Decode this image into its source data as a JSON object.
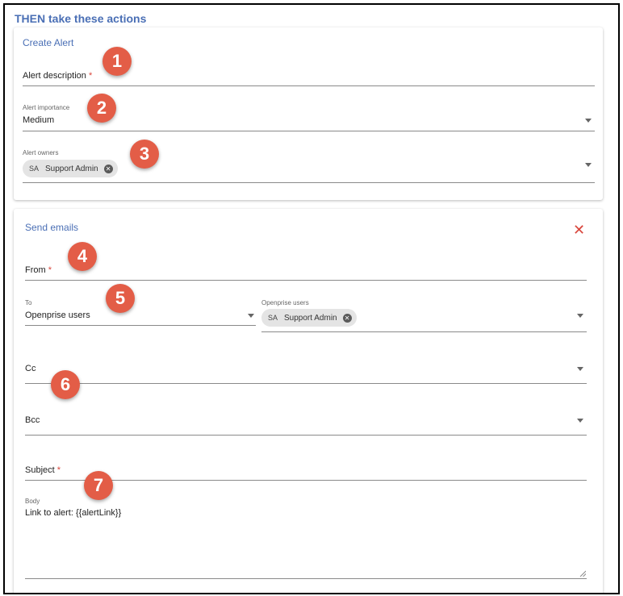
{
  "section_title": "THEN take these actions",
  "create_alert": {
    "title": "Create Alert",
    "description_label": "Alert description",
    "importance_label": "Alert importance",
    "importance_value": "Medium",
    "owners_label": "Alert owners",
    "owner_chip": {
      "initials": "SA",
      "name": "Support Admin"
    }
  },
  "send_emails": {
    "title": "Send emails",
    "from_label": "From",
    "to_label": "To",
    "to_value": "Openprise users",
    "openprise_users_label": "Openprise users",
    "openprise_user_chip": {
      "initials": "SA",
      "name": "Support Admin"
    },
    "cc_label": "Cc",
    "bcc_label": "Bcc",
    "subject_label": "Subject",
    "body_label": "Body",
    "body_value": "Link to alert: {{alertLink}}"
  },
  "required_marker": "*",
  "badges": [
    "1",
    "2",
    "3",
    "4",
    "5",
    "6",
    "7"
  ],
  "colors": {
    "accent": "#4a6fb5",
    "badge": "#e35d47",
    "required": "#d9463c"
  },
  "icons": {
    "close": "close-icon",
    "chip_remove": "chip-remove-icon",
    "dropdown": "dropdown-caret-icon"
  }
}
